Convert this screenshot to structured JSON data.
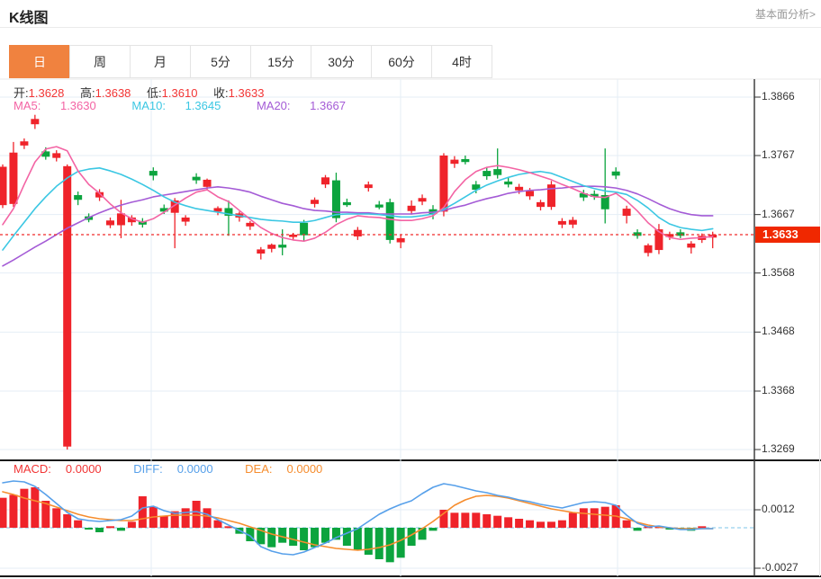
{
  "header": {
    "title": "K线图",
    "analysis_link": "基本面分析>"
  },
  "tabs": {
    "items": [
      "日",
      "周",
      "月",
      "5分",
      "15分",
      "30分",
      "60分",
      "4时"
    ],
    "active": "日"
  },
  "legend": {
    "ohlc": [
      {
        "label": "开:",
        "value": "1.3628"
      },
      {
        "label": "高:",
        "value": "1.3638"
      },
      {
        "label": "低:",
        "value": "1.3610"
      },
      {
        "label": "收:",
        "value": "1.3633"
      }
    ],
    "ma": [
      {
        "label": "MA5:",
        "value": "1.3630",
        "color": "#f364a4"
      },
      {
        "label": "MA10:",
        "value": "1.3645",
        "color": "#3bc7e3"
      },
      {
        "label": "MA20:",
        "value": "1.3667",
        "color": "#a45bd6"
      }
    ]
  },
  "macd_legend": [
    {
      "label": "MACD:",
      "value": "0.0000",
      "color": "#f23535"
    },
    {
      "label": "DIFF:",
      "value": "0.0000",
      "color": "#57a0ea"
    },
    {
      "label": "DEA:",
      "value": "0.0000",
      "color": "#f68d2e"
    }
  ],
  "price_axis": {
    "ticks": [
      "1.3866",
      "1.3767",
      "1.3667",
      "1.3568",
      "1.3468",
      "1.3368",
      "1.3269"
    ],
    "current": "1.3633"
  },
  "macd_axis": {
    "ticks": [
      "0.0012",
      "-0.0027"
    ]
  },
  "colors": {
    "up": "#ef232a",
    "down": "#0ca43e",
    "ma5": "#f364a4",
    "ma10": "#3bc7e3",
    "ma20": "#a45bd6",
    "diff": "#57a0ea",
    "dea": "#f68d2e",
    "grid": "#e4eef6",
    "axis": "#333333",
    "current_line": "#f02b2b",
    "badge_bg": "#f02800",
    "zero_line": "#a8d8f0",
    "active_tab": "#f0823f"
  },
  "chart_data": {
    "type": "candlestick+macd",
    "title": "K线图",
    "convention": "red=up(close>=open), green=down",
    "kline": {
      "ylim": [
        1.3269,
        1.3866
      ],
      "y_ticks": [
        1.3866,
        1.3767,
        1.3667,
        1.3568,
        1.3468,
        1.3368,
        1.3269
      ],
      "current_price": 1.3633,
      "candles": [
        [
          1.3683,
          1.3752,
          1.3678,
          1.3748
        ],
        [
          1.3685,
          1.379,
          1.368,
          1.3772
        ],
        [
          1.3784,
          1.3796,
          1.3778,
          1.3791
        ],
        [
          1.382,
          1.3836,
          1.3812,
          1.3829
        ],
        [
          1.3774,
          1.3781,
          1.376,
          1.3765
        ],
        [
          1.3763,
          1.3776,
          1.3757,
          1.3771
        ],
        [
          1.3274,
          1.3752,
          1.3269,
          1.3749
        ],
        [
          1.37,
          1.3706,
          1.3683,
          1.3692
        ],
        [
          1.3664,
          1.3669,
          1.3654,
          1.3658
        ],
        [
          1.3696,
          1.371,
          1.369,
          1.3705
        ],
        [
          1.3649,
          1.3662,
          1.3644,
          1.3657
        ],
        [
          1.3649,
          1.3692,
          1.3627,
          1.3669
        ],
        [
          1.3654,
          1.3666,
          1.3648,
          1.3662
        ],
        [
          1.3656,
          1.3661,
          1.3645,
          1.365
        ],
        [
          1.3741,
          1.3747,
          1.3725,
          1.3733
        ],
        [
          1.3678,
          1.3684,
          1.3668,
          1.3672
        ],
        [
          1.367,
          1.3695,
          1.361,
          1.3691
        ],
        [
          1.3655,
          1.3666,
          1.3648,
          1.3662
        ],
        [
          1.3731,
          1.3737,
          1.3719,
          1.3725
        ],
        [
          1.3714,
          1.3728,
          1.3708,
          1.3726
        ],
        [
          1.3672,
          1.3681,
          1.3666,
          1.3678
        ],
        [
          1.3678,
          1.3691,
          1.3631,
          1.3665
        ],
        [
          1.3662,
          1.3672,
          1.3655,
          1.3669
        ],
        [
          1.3647,
          1.3656,
          1.3641,
          1.3653
        ],
        [
          1.3601,
          1.3612,
          1.3591,
          1.3608
        ],
        [
          1.3609,
          1.3618,
          1.3603,
          1.3616
        ],
        [
          1.3616,
          1.3642,
          1.3598,
          1.3611
        ],
        [
          1.3629,
          1.3636,
          1.3623,
          1.3633
        ],
        [
          1.3653,
          1.3658,
          1.3622,
          1.3632
        ],
        [
          1.3685,
          1.3696,
          1.3679,
          1.3692
        ],
        [
          1.3718,
          1.3734,
          1.3712,
          1.373
        ],
        [
          1.3725,
          1.3738,
          1.3654,
          1.3661
        ],
        [
          1.3688,
          1.3694,
          1.368,
          1.3683
        ],
        [
          1.363,
          1.3646,
          1.3624,
          1.3641
        ],
        [
          1.3712,
          1.3723,
          1.3706,
          1.3718
        ],
        [
          1.3684,
          1.369,
          1.3676,
          1.3679
        ],
        [
          1.3688,
          1.3694,
          1.3618,
          1.3624
        ],
        [
          1.362,
          1.3633,
          1.361,
          1.3627
        ],
        [
          1.3673,
          1.3691,
          1.3667,
          1.3682
        ],
        [
          1.3689,
          1.3701,
          1.3683,
          1.3695
        ],
        [
          1.3676,
          1.3683,
          1.3659,
          1.3668
        ],
        [
          1.3672,
          1.3771,
          1.3664,
          1.3767
        ],
        [
          1.3753,
          1.3766,
          1.3746,
          1.376
        ],
        [
          1.3761,
          1.3767,
          1.3752,
          1.3756
        ],
        [
          1.3718,
          1.3724,
          1.3703,
          1.3709
        ],
        [
          1.3741,
          1.3748,
          1.3726,
          1.3732
        ],
        [
          1.3744,
          1.3779,
          1.3728,
          1.3734
        ],
        [
          1.3723,
          1.3729,
          1.3713,
          1.3718
        ],
        [
          1.3708,
          1.3719,
          1.3702,
          1.3714
        ],
        [
          1.3698,
          1.3712,
          1.3692,
          1.3707
        ],
        [
          1.368,
          1.3692,
          1.3674,
          1.3688
        ],
        [
          1.368,
          1.3724,
          1.3675,
          1.3718
        ],
        [
          1.365,
          1.3661,
          1.3644,
          1.3656
        ],
        [
          1.365,
          1.3663,
          1.3644,
          1.3658
        ],
        [
          1.3703,
          1.3709,
          1.369,
          1.3696
        ],
        [
          1.3702,
          1.3708,
          1.3692,
          1.3697
        ],
        [
          1.37,
          1.3779,
          1.3652,
          1.3676
        ],
        [
          1.374,
          1.3747,
          1.3727,
          1.3733
        ],
        [
          1.3665,
          1.3682,
          1.3652,
          1.3677
        ],
        [
          1.3637,
          1.3642,
          1.3626,
          1.3631
        ],
        [
          1.3602,
          1.3618,
          1.3596,
          1.3615
        ],
        [
          1.3607,
          1.3651,
          1.36,
          1.3642
        ],
        [
          1.3629,
          1.3638,
          1.3624,
          1.3634
        ],
        [
          1.3637,
          1.3642,
          1.3627,
          1.3631
        ],
        [
          1.3611,
          1.3622,
          1.3601,
          1.3618
        ],
        [
          1.3624,
          1.3635,
          1.3619,
          1.3631
        ],
        [
          1.3628,
          1.3638,
          1.361,
          1.3633
        ]
      ],
      "ma5": [
        1.365,
        1.3677,
        1.3718,
        1.3756,
        1.3778,
        1.3782,
        1.3775,
        1.3741,
        1.3718,
        1.3703,
        1.3685,
        1.367,
        1.366,
        1.3654,
        1.366,
        1.3671,
        1.3683,
        1.3695,
        1.3705,
        1.3709,
        1.3697,
        1.3689,
        1.3674,
        1.3659,
        1.3645,
        1.3635,
        1.3628,
        1.3624,
        1.3622,
        1.3627,
        1.3637,
        1.365,
        1.3659,
        1.3665,
        1.3663,
        1.3662,
        1.3659,
        1.3657,
        1.3657,
        1.366,
        1.3665,
        1.3679,
        1.3706,
        1.3726,
        1.374,
        1.3747,
        1.375,
        1.3747,
        1.3743,
        1.3738,
        1.3732,
        1.3726,
        1.3718,
        1.3711,
        1.3703,
        1.3697,
        1.3696,
        1.3703,
        1.369,
        1.3673,
        1.3653,
        1.3638,
        1.3628,
        1.3625,
        1.3627,
        1.3628,
        1.363
      ],
      "ma10": [
        1.3607,
        1.3631,
        1.3654,
        1.3677,
        1.3697,
        1.3715,
        1.3729,
        1.374,
        1.3744,
        1.3746,
        1.3741,
        1.3735,
        1.3727,
        1.3718,
        1.3708,
        1.3697,
        1.3688,
        1.3682,
        1.3677,
        1.3674,
        1.3671,
        1.3668,
        1.3665,
        1.3662,
        1.3659,
        1.3657,
        1.3656,
        1.3654,
        1.3654,
        1.3657,
        1.3662,
        1.3667,
        1.3668,
        1.3668,
        1.3668,
        1.3667,
        1.3665,
        1.3663,
        1.3663,
        1.3665,
        1.3668,
        1.3676,
        1.3686,
        1.3697,
        1.3708,
        1.3717,
        1.3724,
        1.373,
        1.3735,
        1.3738,
        1.374,
        1.3737,
        1.373,
        1.3723,
        1.3716,
        1.3711,
        1.3707,
        1.3705,
        1.3701,
        1.3691,
        1.3678,
        1.3662,
        1.3651,
        1.3645,
        1.3642,
        1.364,
        1.3643
      ],
      "ma20": [
        1.358,
        1.359,
        1.3601,
        1.3612,
        1.3622,
        1.3633,
        1.3644,
        1.3653,
        1.3662,
        1.367,
        1.3677,
        1.3683,
        1.3688,
        1.3692,
        1.3697,
        1.37,
        1.3703,
        1.3706,
        1.3709,
        1.3712,
        1.3714,
        1.3712,
        1.3709,
        1.3705,
        1.3698,
        1.3692,
        1.3686,
        1.3682,
        1.3677,
        1.3674,
        1.3673,
        1.3671,
        1.3671,
        1.367,
        1.367,
        1.3668,
        1.3668,
        1.3668,
        1.3668,
        1.367,
        1.3671,
        1.3674,
        1.3679,
        1.3683,
        1.3689,
        1.3694,
        1.3698,
        1.3703,
        1.3706,
        1.3708,
        1.3709,
        1.3711,
        1.3712,
        1.3714,
        1.3715,
        1.3715,
        1.3714,
        1.3712,
        1.3708,
        1.3702,
        1.3694,
        1.3685,
        1.3677,
        1.3671,
        1.3667,
        1.3665,
        1.3665
      ]
    },
    "macd": {
      "y_ticks": [
        0.0012,
        -0.0027
      ],
      "hist": [
        0.002,
        0.0022,
        0.0026,
        0.0027,
        0.0018,
        0.0013,
        0.0009,
        0.0005,
        -0.0001,
        -0.0003,
        0.0001,
        -0.0002,
        0.0004,
        0.0021,
        0.0014,
        0.0008,
        0.0011,
        0.0013,
        0.0018,
        0.0013,
        0.0005,
        0.0001,
        -0.0004,
        -0.0009,
        -0.0011,
        -0.0013,
        -0.001,
        -0.0012,
        -0.0015,
        -0.0013,
        -0.001,
        -0.0008,
        -0.0012,
        -0.0015,
        -0.0018,
        -0.0021,
        -0.0023,
        -0.002,
        -0.0012,
        -0.0008,
        -0.0002,
        0.0012,
        0.001,
        0.001,
        0.001,
        0.0009,
        0.0008,
        0.0007,
        0.0006,
        0.0005,
        0.0004,
        0.0004,
        0.0005,
        0.001,
        0.0013,
        0.0013,
        0.0014,
        0.0015,
        0.0005,
        -0.0002,
        0.0001,
        0.0001,
        -0.0001,
        -0.0001,
        -0.0002,
        0.0001,
        0.0
      ],
      "diff": [
        0.003,
        0.00312,
        0.00306,
        0.00276,
        0.00222,
        0.00162,
        0.00102,
        0.0006,
        0.00048,
        0.00042,
        0.00048,
        0.00054,
        0.00078,
        0.00132,
        0.00144,
        0.00114,
        0.00096,
        0.00102,
        0.00108,
        0.0009,
        0.00054,
        0.00018,
        -0.00018,
        -0.00054,
        -0.00126,
        -0.00156,
        -0.00174,
        -0.0018,
        -0.00162,
        -0.00132,
        -0.00102,
        -0.00066,
        -0.00036,
        -6e-05,
        0.00042,
        0.0009,
        0.00126,
        0.00156,
        0.0018,
        0.00228,
        0.0027,
        0.00294,
        0.00282,
        0.00264,
        0.00246,
        0.00234,
        0.00216,
        0.00204,
        0.00186,
        0.00174,
        0.00156,
        0.00144,
        0.00132,
        0.0015,
        0.00168,
        0.00174,
        0.00168,
        0.0015,
        0.00084,
        0.0003,
        6e-05,
        0.00012,
        0.0,
        -0.00012,
        -0.00012,
        -6e-05,
        -6e-05
      ],
      "dea": [
        0.0024,
        0.00222,
        0.00198,
        0.0018,
        0.00162,
        0.00138,
        0.00114,
        0.0009,
        0.00072,
        0.0006,
        0.00054,
        0.00048,
        0.00048,
        0.0006,
        0.00072,
        0.00078,
        0.00084,
        0.00084,
        0.00084,
        0.00078,
        0.00066,
        0.00048,
        0.0003,
        6e-05,
        -0.00018,
        -0.00042,
        -0.0006,
        -0.00078,
        -0.00096,
        -0.00114,
        -0.00126,
        -0.00138,
        -0.00144,
        -0.0015,
        -0.00144,
        -0.00132,
        -0.00114,
        -0.00084,
        -0.00048,
        -6e-05,
        0.00042,
        0.00096,
        0.0015,
        0.00186,
        0.0021,
        0.00216,
        0.0021,
        0.00198,
        0.0018,
        0.00162,
        0.00144,
        0.00126,
        0.00114,
        0.00102,
        0.00096,
        0.0009,
        0.00084,
        0.00078,
        0.0006,
        0.00036,
        0.00018,
        6e-05,
        0.0,
        -6e-05,
        -6e-05,
        -6e-05,
        -6e-05
      ]
    }
  }
}
